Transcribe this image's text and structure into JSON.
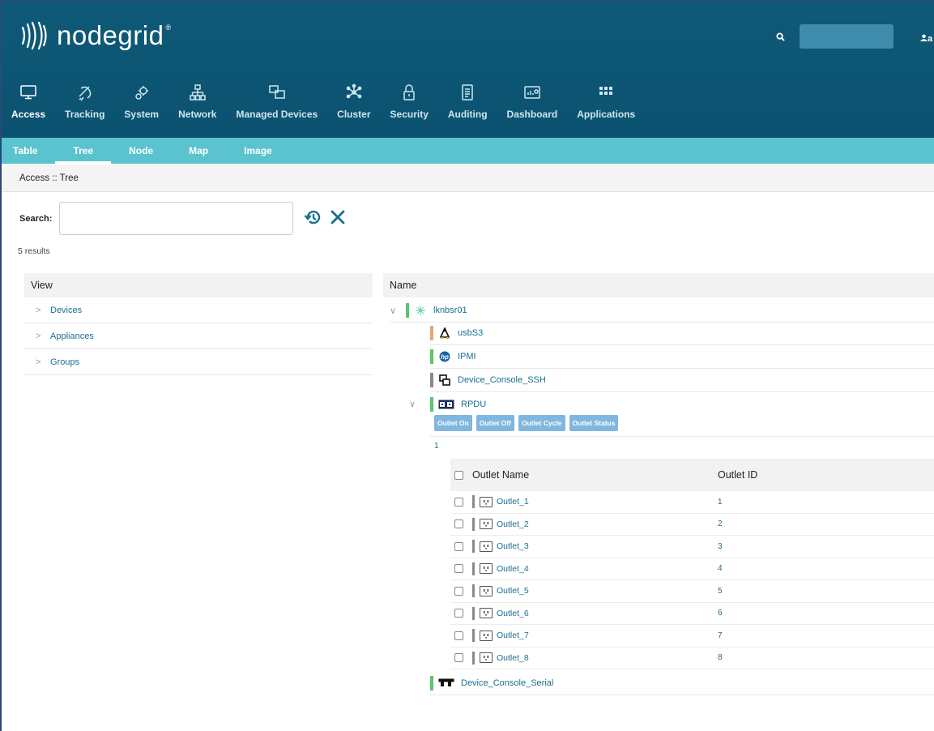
{
  "brand": {
    "name": "nodegrid",
    "reg": "®"
  },
  "top": {
    "search_icon": "search-icon",
    "user_label": "a"
  },
  "nav": [
    {
      "label": "Access",
      "icon": "monitor-icon",
      "active": true
    },
    {
      "label": "Tracking",
      "icon": "satellite-icon",
      "active": false
    },
    {
      "label": "System",
      "icon": "gears-icon",
      "active": false
    },
    {
      "label": "Network",
      "icon": "network-icon",
      "active": false
    },
    {
      "label": "Managed Devices",
      "icon": "devices-icon",
      "active": false
    },
    {
      "label": "Cluster",
      "icon": "cluster-icon",
      "active": false
    },
    {
      "label": "Security",
      "icon": "lock-icon",
      "active": false
    },
    {
      "label": "Auditing",
      "icon": "clipboard-icon",
      "active": false
    },
    {
      "label": "Dashboard",
      "icon": "dashboard-icon",
      "active": false
    },
    {
      "label": "Applications",
      "icon": "apps-grid-icon",
      "active": false
    }
  ],
  "subnav": [
    "Table",
    "Tree",
    "Node",
    "Map",
    "Image"
  ],
  "subnav_active": "Tree",
  "breadcrumb": "Access :: Tree",
  "search": {
    "label": "Search:",
    "value": "",
    "results": "5 results"
  },
  "view": {
    "header": "View",
    "items": [
      "Devices",
      "Appliances",
      "Groups"
    ]
  },
  "tree": {
    "header": "Name",
    "root": "lknbsr01",
    "children": [
      {
        "name": "usbS3",
        "icon": "linux-icon",
        "bar": "#e3a77a"
      },
      {
        "name": "IPMI",
        "icon": "hp-icon",
        "bar": "#5cc46a"
      },
      {
        "name": "Device_Console_SSH",
        "icon": "console-icon",
        "bar": "#8a8a8a"
      },
      {
        "name": "RPDU",
        "icon": "pdu-icon",
        "bar": "#5cc46a"
      }
    ],
    "last": {
      "name": "Device_Console_Serial",
      "icon": "serial-icon",
      "bar": "#5cc46a"
    }
  },
  "outlet_buttons": [
    "Outlet On",
    "Outlet Off",
    "Outlet Cycle",
    "Outlet Status"
  ],
  "page": "1",
  "outlets": {
    "headers": [
      "Outlet Name",
      "Outlet ID"
    ],
    "rows": [
      {
        "name": "Outlet_1",
        "id": "1"
      },
      {
        "name": "Outlet_2",
        "id": "2"
      },
      {
        "name": "Outlet_3",
        "id": "3"
      },
      {
        "name": "Outlet_4",
        "id": "4"
      },
      {
        "name": "Outlet_5",
        "id": "5"
      },
      {
        "name": "Outlet_6",
        "id": "6"
      },
      {
        "name": "Outlet_7",
        "id": "7"
      },
      {
        "name": "Outlet_8",
        "id": "8"
      }
    ]
  },
  "colors": {
    "header": "#0c5573",
    "subnav": "#5bc3cf",
    "link": "#1a6e8e",
    "button": "#7fb7de"
  }
}
